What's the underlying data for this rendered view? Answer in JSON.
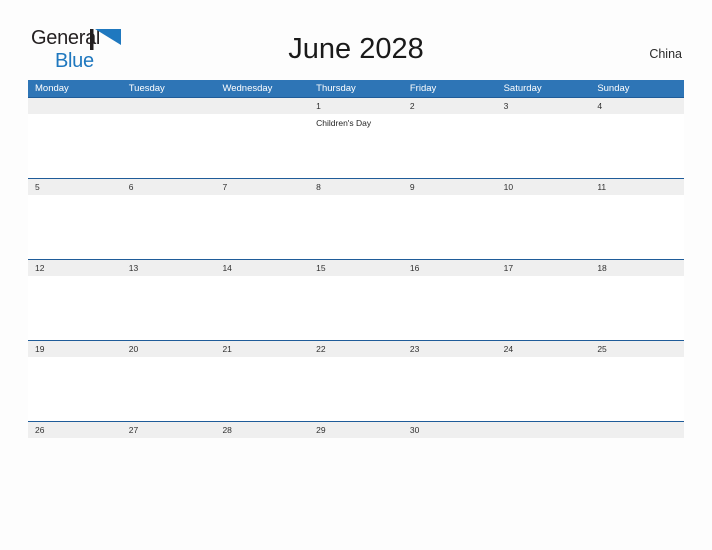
{
  "brand": {
    "name_part1": "General",
    "name_part2": "Blue",
    "flag_icon": "blue-flag-icon",
    "accent_color": "#1f78bf",
    "text_color": "#231f20"
  },
  "header": {
    "title": "June 2028",
    "country": "China"
  },
  "colors": {
    "header_blue": "#2e75b6",
    "row_rule_blue": "#1f5c99",
    "date_band_gray": "#efefef",
    "page_background": "#fdfdfd"
  },
  "calendar": {
    "month": "June",
    "year": "2028",
    "weekdays": [
      "Monday",
      "Tuesday",
      "Wednesday",
      "Thursday",
      "Friday",
      "Saturday",
      "Sunday"
    ],
    "weeks": [
      {
        "days": [
          {
            "date": "",
            "events": []
          },
          {
            "date": "",
            "events": []
          },
          {
            "date": "",
            "events": []
          },
          {
            "date": "1",
            "events": [
              "Children's Day"
            ]
          },
          {
            "date": "2",
            "events": []
          },
          {
            "date": "3",
            "events": []
          },
          {
            "date": "4",
            "events": []
          }
        ]
      },
      {
        "days": [
          {
            "date": "5",
            "events": []
          },
          {
            "date": "6",
            "events": []
          },
          {
            "date": "7",
            "events": []
          },
          {
            "date": "8",
            "events": []
          },
          {
            "date": "9",
            "events": []
          },
          {
            "date": "10",
            "events": []
          },
          {
            "date": "11",
            "events": []
          }
        ]
      },
      {
        "days": [
          {
            "date": "12",
            "events": []
          },
          {
            "date": "13",
            "events": []
          },
          {
            "date": "14",
            "events": []
          },
          {
            "date": "15",
            "events": []
          },
          {
            "date": "16",
            "events": []
          },
          {
            "date": "17",
            "events": []
          },
          {
            "date": "18",
            "events": []
          }
        ]
      },
      {
        "days": [
          {
            "date": "19",
            "events": []
          },
          {
            "date": "20",
            "events": []
          },
          {
            "date": "21",
            "events": []
          },
          {
            "date": "22",
            "events": []
          },
          {
            "date": "23",
            "events": []
          },
          {
            "date": "24",
            "events": []
          },
          {
            "date": "25",
            "events": []
          }
        ]
      },
      {
        "days": [
          {
            "date": "26",
            "events": []
          },
          {
            "date": "27",
            "events": []
          },
          {
            "date": "28",
            "events": []
          },
          {
            "date": "29",
            "events": []
          },
          {
            "date": "30",
            "events": []
          },
          {
            "date": "",
            "events": []
          },
          {
            "date": "",
            "events": []
          }
        ]
      }
    ]
  }
}
